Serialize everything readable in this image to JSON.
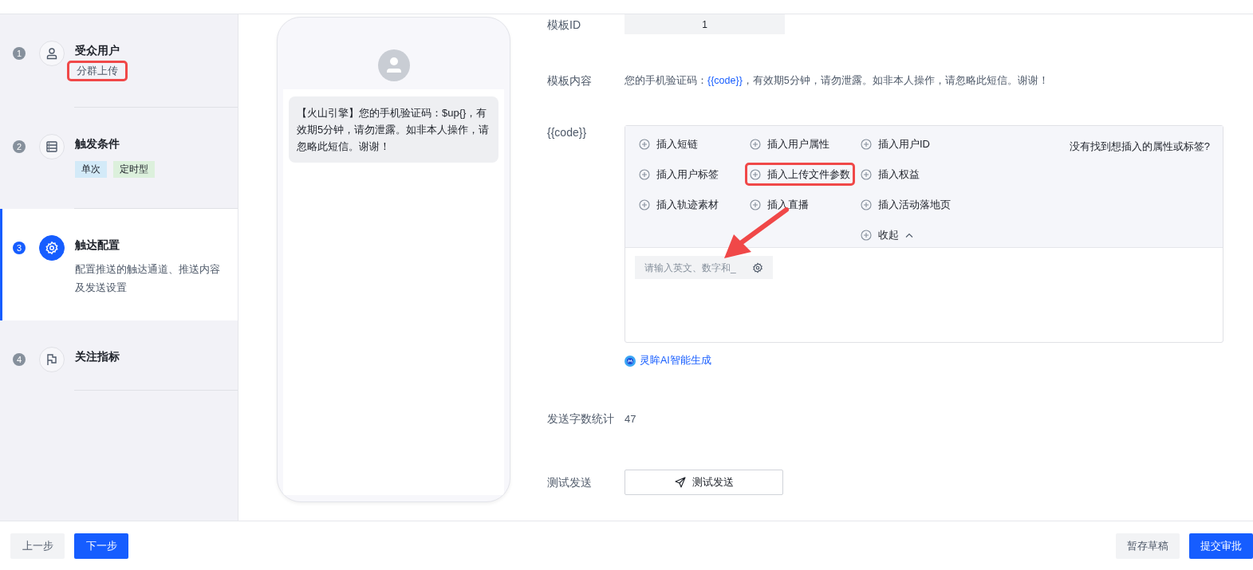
{
  "steps": [
    {
      "number": "1",
      "title": "受众用户",
      "selected": false,
      "note": {
        "text": "分群上传",
        "highlighted": true
      }
    },
    {
      "number": "2",
      "title": "触发条件",
      "selected": false,
      "tags": [
        {
          "text": "单次",
          "color": "#d3eaf8"
        },
        {
          "text": "定时型",
          "color": "#dcf0dc"
        }
      ]
    },
    {
      "number": "3",
      "title": "触达配置",
      "selected": true,
      "description": "配置推送的触达通道、推送内容及发送设置"
    },
    {
      "number": "4",
      "title": "关注指标",
      "selected": false
    }
  ],
  "preview": {
    "message": "【火山引擎】您的手机验证码：$up{}，有效期5分钟，请勿泄露。如非本人操作，请忽略此短信。谢谢！"
  },
  "form": {
    "template_id": {
      "label": "模板ID",
      "value": "1"
    },
    "template_content": {
      "label": "模板内容",
      "parts": [
        {
          "kind": "plain",
          "text": "您的手机验证码："
        },
        {
          "kind": "variable",
          "text": "{{code}}"
        },
        {
          "kind": "plain",
          "text": "，有效期5分钟，请勿泄露。如非本人操作，请忽略此短信。谢谢！"
        }
      ]
    },
    "variable": {
      "label": "{{code}}",
      "insert_options": [
        {
          "kind": "insert",
          "text": "插入短链",
          "highlighted": false
        },
        {
          "kind": "insert",
          "text": "插入用户属性",
          "highlighted": false
        },
        {
          "kind": "insert",
          "text": "插入用户ID",
          "highlighted": false
        },
        {
          "kind": "insert",
          "text": "插入用户标签",
          "highlighted": false
        },
        {
          "kind": "insert",
          "text": "插入上传文件参数",
          "highlighted": true
        },
        {
          "kind": "insert",
          "text": "插入权益",
          "highlighted": false
        },
        {
          "kind": "insert",
          "text": "插入轨迹素材",
          "highlighted": false
        },
        {
          "kind": "insert",
          "text": "插入直播",
          "highlighted": false
        },
        {
          "kind": "insert",
          "text": "插入活动落地页",
          "highlighted": false
        },
        {
          "kind": "collapse",
          "text": "收起",
          "highlighted": false
        }
      ],
      "help_link": "没有找到想插入的属性或标签?",
      "input": {
        "placeholder": "请输入英文、数字和_"
      },
      "ai_link": "灵眸AI智能生成"
    },
    "char_count": {
      "label": "发送字数统计",
      "value": "47"
    },
    "test_send": {
      "label": "测试发送",
      "button": "测试发送"
    }
  },
  "footer": {
    "left": [
      {
        "text": "上一步",
        "kind": "secondary"
      },
      {
        "text": "下一步",
        "kind": "primary"
      }
    ],
    "right": [
      {
        "text": "暂存草稿",
        "kind": "secondary"
      },
      {
        "text": "提交审批",
        "kind": "primary"
      }
    ]
  }
}
